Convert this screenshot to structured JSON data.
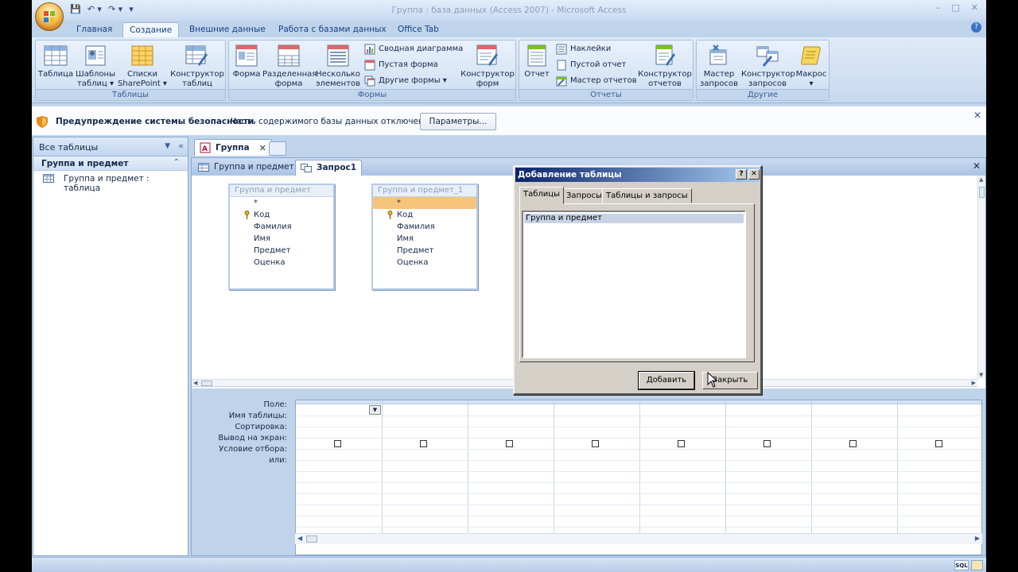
{
  "window": {
    "title": "Группа : база данных (Access 2007) - Microsoft Access",
    "controls": [
      "–",
      "□",
      "✕"
    ]
  },
  "quick_access": [
    "💾",
    "↶ ▾",
    "↷ ▾",
    "▾"
  ],
  "ribbon": {
    "tabs": [
      "Главная",
      "Создание",
      "Внешние данные",
      "Работа с базами данных",
      "Office Tab"
    ],
    "active_tab": "Создание",
    "groups": {
      "tables": {
        "label": "Таблицы",
        "buttons": [
          {
            "l1": "Таблица",
            "l2": ""
          },
          {
            "l1": "Шаблоны",
            "l2": "таблиц ▾"
          },
          {
            "l1": "Списки",
            "l2": "SharePoint ▾"
          },
          {
            "l1": "Конструктор",
            "l2": "таблиц"
          }
        ]
      },
      "forms": {
        "label": "Формы",
        "buttons": [
          {
            "l1": "Форма",
            "l2": ""
          },
          {
            "l1": "Разделенная",
            "l2": "форма"
          },
          {
            "l1": "Несколько",
            "l2": "элементов"
          }
        ],
        "small": [
          "Сводная диаграмма",
          "Пустая форма",
          "Другие формы ▾"
        ],
        "designer": {
          "l1": "Конструктор",
          "l2": "форм"
        }
      },
      "reports": {
        "label": "Отчеты",
        "report": "Отчет",
        "small": [
          "Наклейки",
          "Пустой отчет",
          "Мастер отчетов"
        ],
        "designer": {
          "l1": "Конструктор",
          "l2": "отчетов"
        }
      },
      "other": {
        "label": "Другие",
        "buttons": [
          {
            "l1": "Мастер",
            "l2": "запросов"
          },
          {
            "l1": "Конструктор",
            "l2": "запросов"
          },
          {
            "l1": "Макрос",
            "l2": "▾"
          }
        ]
      }
    }
  },
  "security_bar": {
    "title": "Предупреждение системы безопасности",
    "text": "Часть содержимого базы данных отключено",
    "button": "Параметры..."
  },
  "nav_pane": {
    "header": "Все таблицы",
    "group": "Группа и предмет",
    "items": [
      "Группа и предмет : таблица"
    ]
  },
  "doc_tabs": [
    {
      "label": "Группа"
    }
  ],
  "object_tabs": [
    "Группа и предмет",
    "Запрос1"
  ],
  "field_lists": [
    {
      "title": "Группа и предмет",
      "fields": [
        "*",
        "Код",
        "Фамилия",
        "Имя",
        "Предмет",
        "Оценка"
      ]
    },
    {
      "title": "Группа и предмет_1",
      "fields": [
        "*",
        "Код",
        "Фамилия",
        "Имя",
        "Предмет",
        "Оценка"
      ]
    }
  ],
  "grid": {
    "row_labels": [
      "Поле:",
      "Имя таблицы:",
      "Сортировка:",
      "Вывод на экран:",
      "Условие отбора:",
      "или:"
    ]
  },
  "dialog": {
    "title": "Добавление таблицы",
    "tabs": [
      "Таблицы",
      "Запросы",
      "Таблицы и запросы"
    ],
    "active_tab": "Таблицы",
    "items": [
      "Группа и предмет"
    ],
    "buttons": {
      "add": "Добавить",
      "close": "Закрыть"
    }
  },
  "status_bar": {
    "sql": "SQL"
  },
  "colors": {
    "accent": "#15428b",
    "ribbon": "#c7d9ef",
    "dialog_title": "#0a246a",
    "selected_field": "#f6c47a"
  }
}
